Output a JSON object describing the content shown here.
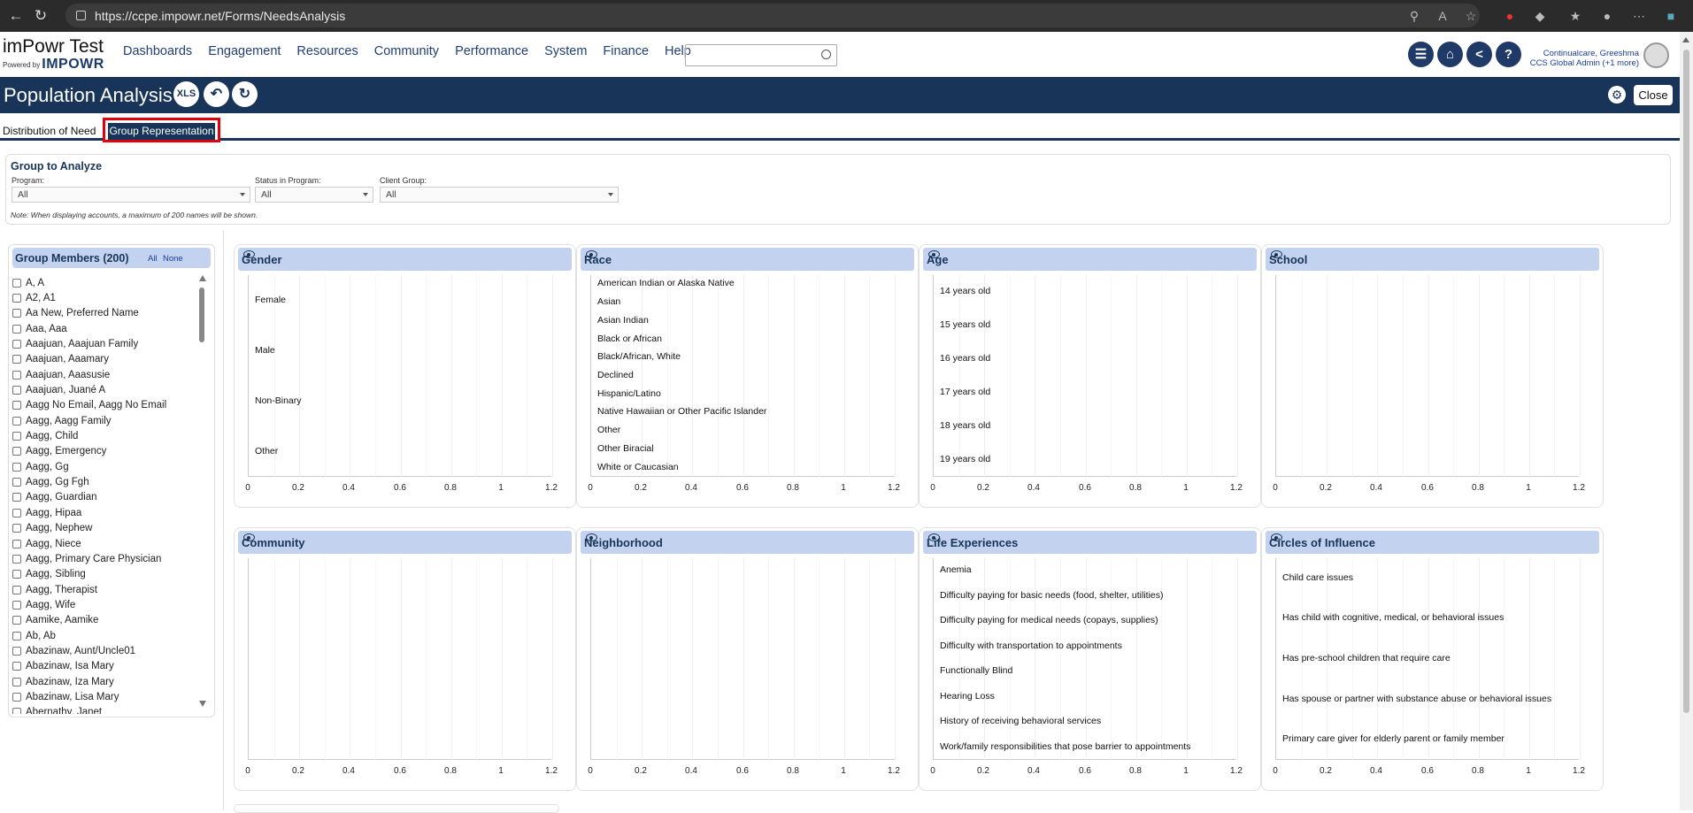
{
  "browser": {
    "url": "https://ccpe.impowr.net/Forms/NeedsAnalysis"
  },
  "app": {
    "title": "imPowr Test",
    "powered_by": "Powered by",
    "brand": "IMPOWR"
  },
  "nav": [
    "Dashboards",
    "Engagement",
    "Resources",
    "Community",
    "Performance",
    "System",
    "Finance",
    "Help"
  ],
  "search": {
    "placeholder": ""
  },
  "user": {
    "name": "Continualcare, Greeshma",
    "role": "CCS Global Admin (+1 more)"
  },
  "page": {
    "title": "Population Analysis",
    "xls": "XLS",
    "close": "Close"
  },
  "tabs": {
    "distribution": "Distribution of Need",
    "group": "Group Representation"
  },
  "filters": {
    "title": "Group to Analyze",
    "program_label": "Program:",
    "program_value": "All",
    "status_label": "Status in Program:",
    "status_value": "All",
    "client_label": "Client Group:",
    "client_value": "All",
    "note": "Note: When displaying accounts, a maximum of 200 names will be shown."
  },
  "members": {
    "title": "Group Members (200)",
    "all": "All",
    "none": "None",
    "items": [
      "A, A",
      "A2, A1",
      "Aa New, Preferred Name",
      "Aaa, Aaa",
      "Aaajuan, Aaajuan Family",
      "Aaajuan, Aaamary",
      "Aaajuan, Aaasusie",
      "Aaajuan, Juané A",
      "Aagg No Email, Aagg No Email",
      "Aagg, Aagg Family",
      "Aagg, Child",
      "Aagg, Emergency",
      "Aagg, Gg",
      "Aagg, Gg Fgh",
      "Aagg, Guardian",
      "Aagg, Hipaa",
      "Aagg, Nephew",
      "Aagg, Niece",
      "Aagg, Primary Care Physician",
      "Aagg, Sibling",
      "Aagg, Therapist",
      "Aagg, Wife",
      "Aamike, Aamike",
      "Ab, Ab",
      "Abazinaw, Aunt/Uncle01",
      "Abazinaw, Isa Mary",
      "Abazinaw, Iza Mary",
      "Abazinaw, Lisa Mary",
      "Abernathy, Janet"
    ]
  },
  "chart_data": [
    {
      "type": "bar",
      "title": "Gender",
      "categories": [
        "Female",
        "Male",
        "Non-Binary",
        "Other"
      ],
      "values": [
        0,
        0,
        0,
        0
      ],
      "xticks": [
        "0",
        "0.2",
        "0.4",
        "0.6",
        "0.8",
        "1",
        "1.2"
      ],
      "xlim": [
        0,
        1.2
      ],
      "grid": true
    },
    {
      "type": "bar",
      "title": "Race",
      "categories": [
        "American Indian or Alaska Native",
        "Asian",
        "Asian Indian",
        "Black or African",
        "Black/African, White",
        "Declined",
        "Hispanic/Latino",
        "Native Hawaiian or Other Pacific Islander",
        "Other",
        "Other Biracial",
        "White or Caucasian"
      ],
      "values": [
        0,
        0,
        0,
        0,
        0,
        0,
        0,
        0,
        0,
        0,
        0
      ],
      "xticks": [
        "0",
        "0.2",
        "0.4",
        "0.6",
        "0.8",
        "1",
        "1.2"
      ],
      "xlim": [
        0,
        1.2
      ],
      "grid": true
    },
    {
      "type": "bar",
      "title": "Age",
      "categories": [
        "14 years old",
        "15 years old",
        "16 years old",
        "17 years old",
        "18 years old",
        "19 years old"
      ],
      "values": [
        0,
        0,
        0,
        0,
        0,
        0
      ],
      "xticks": [
        "0",
        "0.2",
        "0.4",
        "0.6",
        "0.8",
        "1",
        "1.2"
      ],
      "xlim": [
        0,
        1.2
      ],
      "grid": true
    },
    {
      "type": "bar",
      "title": "School",
      "categories": [],
      "values": [],
      "xticks": [
        "0",
        "0.2",
        "0.4",
        "0.6",
        "0.8",
        "1",
        "1.2"
      ],
      "xlim": [
        0,
        1.2
      ],
      "grid": true
    },
    {
      "type": "bar",
      "title": "Community",
      "categories": [],
      "values": [],
      "xticks": [
        "0",
        "0.2",
        "0.4",
        "0.6",
        "0.8",
        "1",
        "1.2"
      ],
      "xlim": [
        0,
        1.2
      ],
      "grid": true
    },
    {
      "type": "bar",
      "title": "Neighborhood",
      "categories": [],
      "values": [],
      "xticks": [
        "0",
        "0.2",
        "0.4",
        "0.6",
        "0.8",
        "1",
        "1.2"
      ],
      "xlim": [
        0,
        1.2
      ],
      "grid": true
    },
    {
      "type": "bar",
      "title": "Life Experiences",
      "categories": [
        "Anemia",
        "Difficulty paying for basic needs (food, shelter, utilities)",
        "Difficulty paying for medical needs (copays, supplies)",
        "Difficulty with transportation to appointments",
        "Functionally Blind",
        "Hearing Loss",
        "History of receiving behavioral services",
        "Work/family responsibilities that pose barrier to appointments"
      ],
      "values": [
        0,
        0,
        0,
        0,
        0,
        0,
        0,
        0
      ],
      "xticks": [
        "0",
        "0.2",
        "0.4",
        "0.6",
        "0.8",
        "1",
        "1.2"
      ],
      "xlim": [
        0,
        1.2
      ],
      "grid": true
    },
    {
      "type": "bar",
      "title": "Circles of Influence",
      "categories": [
        "Child care issues",
        "Has child with cognitive, medical, or behavioral issues",
        "Has pre-school children that require care",
        "Has spouse or partner with substance abuse or behavioral issues",
        "Primary care giver for elderly parent or family member"
      ],
      "values": [
        0,
        0,
        0,
        0,
        0
      ],
      "xticks": [
        "0",
        "0.2",
        "0.4",
        "0.6",
        "0.8",
        "1",
        "1.2"
      ],
      "xlim": [
        0,
        1.2
      ],
      "grid": true
    }
  ]
}
